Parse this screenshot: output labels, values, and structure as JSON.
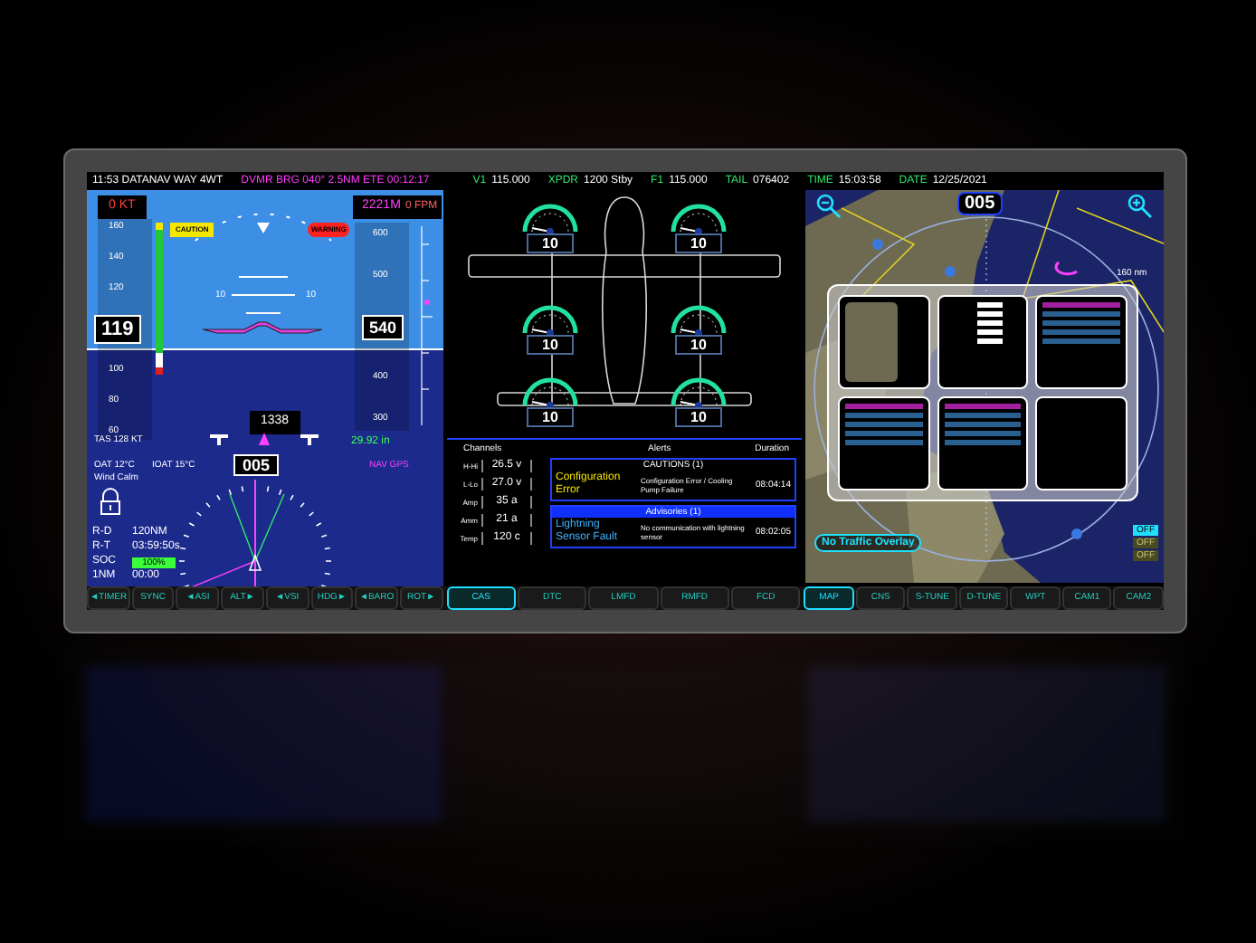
{
  "status_bar": [
    {
      "kind": "text",
      "text": "11:53 DATANAV WAY 4WT"
    },
    {
      "kind": "route",
      "text": "DVMR  BRG 040°  2.5NM  ETE 00:12:17"
    },
    {
      "kind": "field",
      "label": "V1",
      "value": "115.000"
    },
    {
      "kind": "field",
      "label": "XPDR",
      "value": "1200  Stby"
    },
    {
      "kind": "field",
      "label": "F1",
      "value": "115.000"
    },
    {
      "kind": "field",
      "label": "TAIL",
      "value": "076402"
    },
    {
      "kind": "field",
      "label": "TIME",
      "value": "15:03:58"
    },
    {
      "kind": "field",
      "label": "DATE",
      "value": "12/25/2021"
    }
  ],
  "pfd": {
    "ground_speed": "0 KT",
    "selected_altitude": "2221M",
    "vertical_speed": "0 FPM",
    "caution": "CAUTION",
    "warning": "WARNING",
    "speed_ticks": [
      "160",
      "140",
      "120",
      "100",
      "80",
      "60"
    ],
    "airspeed": "119",
    "altitude": "540",
    "alt_ticks": [
      "600",
      "500",
      "400",
      "300"
    ],
    "pitch_labels": [
      "10",
      "10"
    ],
    "reference": "1338",
    "tas": "TAS 128 KT",
    "baro": "29.92 in",
    "oat": "OAT 12°C",
    "ioat": "IOAT 15°C",
    "wind": "Wind Calm",
    "nav_source": "NAV  GPS",
    "heading": "005",
    "readouts": [
      {
        "label": "R-D",
        "value": "120NM"
      },
      {
        "label": "R-T",
        "value": "03:59:50s"
      },
      {
        "label": "SOC",
        "value": "100%",
        "kind": "bar",
        "level": 1
      },
      {
        "label": "1NM",
        "value": "00:00"
      }
    ]
  },
  "engine": {
    "gauges": [
      {
        "value": "10"
      },
      {
        "value": "10"
      },
      {
        "value": "10"
      },
      {
        "value": "10"
      },
      {
        "value": "10"
      },
      {
        "value": "10"
      }
    ],
    "channels_title": "Channels",
    "channels": [
      {
        "label": "H-Hi",
        "value": "26.5 v"
      },
      {
        "label": "L-Lo",
        "value": "27.0 v"
      },
      {
        "label": "Amp",
        "value": "35 a"
      },
      {
        "label": "Amm",
        "value": "21 a"
      },
      {
        "label": "Temp",
        "value": "120 c"
      }
    ],
    "alerts_title": "Alerts",
    "duration_header": "Duration",
    "alerts": [
      {
        "kind": "caution",
        "header": "CAUTIONS (1)",
        "title": "Configuration Error",
        "message": "Configuration Error / Cooling Pump Failure",
        "time": "08:04:14"
      },
      {
        "kind": "advisory",
        "header": "Advisories (1)",
        "title": "Lightning Sensor Fault",
        "message": "No communication with lightning sensor",
        "time": "08:02:05"
      }
    ]
  },
  "map": {
    "heading": "005",
    "range": "160 nm",
    "traffic": "No Traffic Overlay",
    "toggles": [
      {
        "label": "OFF",
        "selected": true
      },
      {
        "label": "OFF",
        "selected": false
      },
      {
        "label": "OFF",
        "selected": false
      }
    ],
    "thumbnails": [
      {
        "kind": "map"
      },
      {
        "kind": "form"
      },
      {
        "kind": "list"
      },
      {
        "kind": "list"
      },
      {
        "kind": "list"
      },
      {
        "kind": "blank"
      }
    ]
  },
  "softkey_groups": [
    {
      "keys": [
        {
          "label": "◄TIMER",
          "selected": false
        },
        {
          "label": "SYNC",
          "selected": false
        },
        {
          "label": "◄ASI",
          "selected": false
        },
        {
          "label": "ALT►",
          "selected": false
        },
        {
          "label": "◄VSI",
          "selected": false
        },
        {
          "label": "HDG►",
          "selected": false
        },
        {
          "label": "◄BARO",
          "selected": false
        },
        {
          "label": "ROT►",
          "selected": false
        }
      ]
    },
    {
      "keys": [
        {
          "label": "CAS",
          "selected": true
        },
        {
          "label": "DTC",
          "selected": false
        },
        {
          "label": "LMFD",
          "selected": false
        },
        {
          "label": "RMFD",
          "selected": false
        },
        {
          "label": "FCD",
          "selected": false
        }
      ]
    },
    {
      "keys": [
        {
          "label": "MAP",
          "selected": true
        },
        {
          "label": "CNS",
          "selected": false
        },
        {
          "label": "S-TUNE",
          "selected": false
        },
        {
          "label": "D-TUNE",
          "selected": false
        },
        {
          "label": "WPT",
          "selected": false
        },
        {
          "label": "CAM1",
          "selected": false
        },
        {
          "label": "CAM2",
          "selected": false
        }
      ]
    }
  ]
}
